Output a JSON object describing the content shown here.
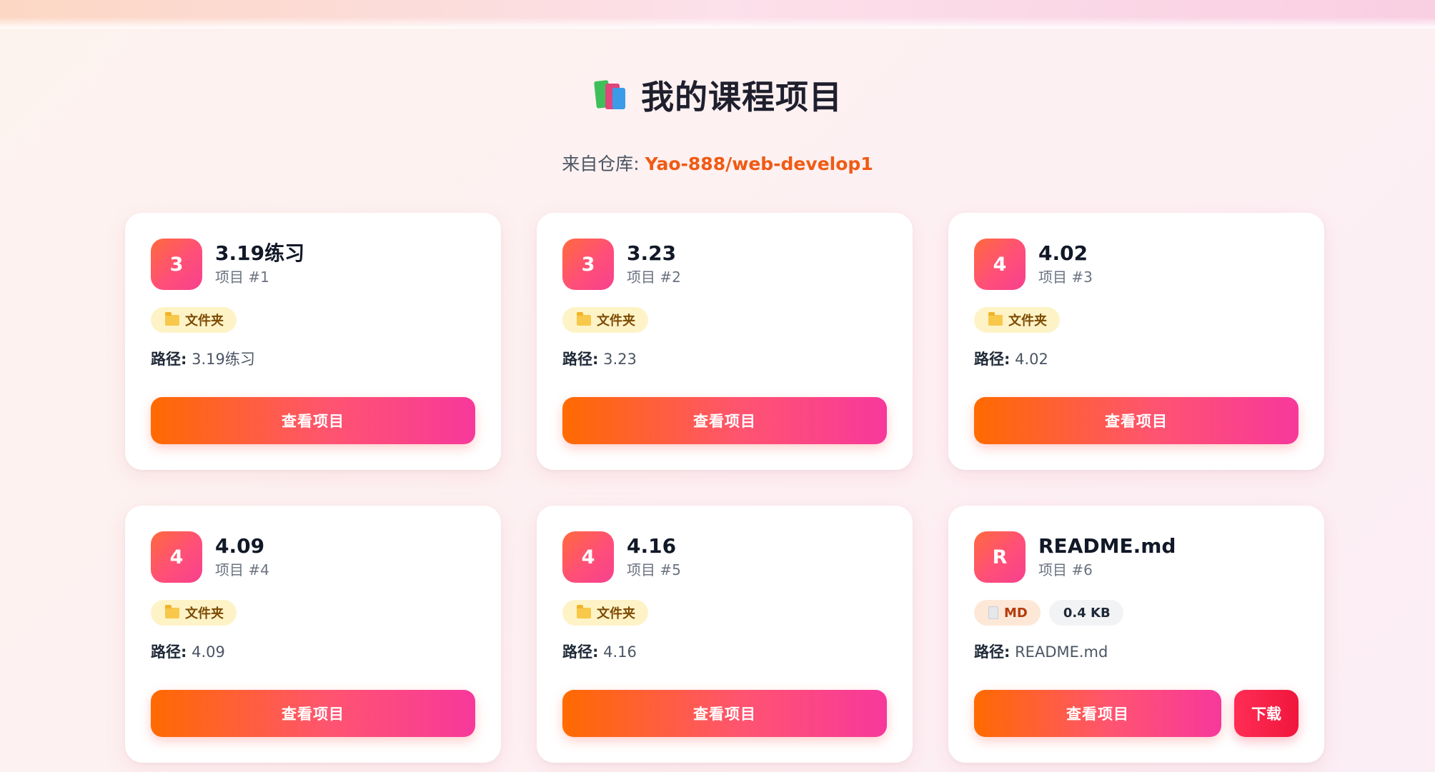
{
  "header": {
    "title": "我的课程项目",
    "subtitle_prefix": "来自仓库: ",
    "repo": "Yao-888/web-develop1",
    "title_icon": "books-icon"
  },
  "theme": {
    "accent": "#ff6a00",
    "accent_pink": "#f7389c",
    "repo_color": "#f05a14",
    "download": "#f0163c"
  },
  "path_label": "路径:",
  "view_label": "查看项目",
  "download_label": "下载",
  "projects": [
    {
      "initial": "3",
      "title": "3.19练习",
      "sub": "项目 #1",
      "tag": "文件夹",
      "path": "3.19练习"
    },
    {
      "initial": "3",
      "title": "3.23",
      "sub": "项目 #2",
      "tag": "文件夹",
      "path": "3.23"
    },
    {
      "initial": "4",
      "title": "4.02",
      "sub": "项目 #3",
      "tag": "文件夹",
      "path": "4.02"
    },
    {
      "initial": "4",
      "title": "4.09",
      "sub": "项目 #4",
      "tag": "文件夹",
      "path": "4.09"
    },
    {
      "initial": "4",
      "title": "4.16",
      "sub": "项目 #5",
      "tag": "文件夹",
      "path": "4.16"
    },
    {
      "initial": "R",
      "title": "README.md",
      "sub": "项目 #6",
      "tag": "MD",
      "size": "0.4 KB",
      "path": "README.md"
    }
  ]
}
